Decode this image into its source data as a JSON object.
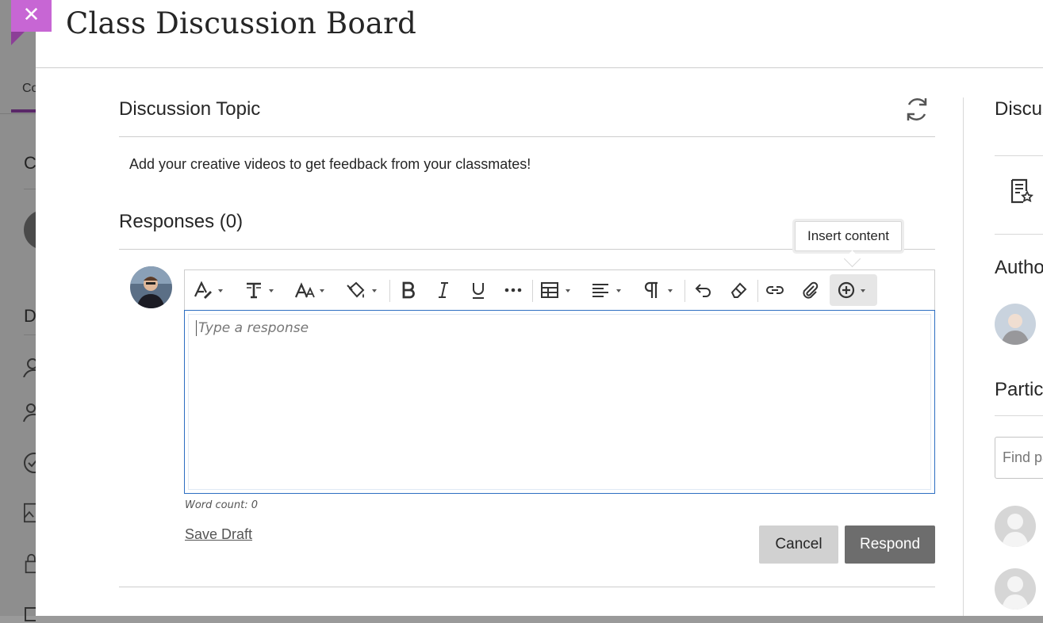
{
  "background": {
    "tab_label": "Co",
    "letters": [
      "C",
      "D"
    ]
  },
  "close_button": {
    "label": "✕"
  },
  "header": {
    "title": "Class Discussion Board"
  },
  "topic": {
    "heading": "Discussion Topic",
    "text": "Add your creative videos to get feedback from your classmates!"
  },
  "responses": {
    "heading": "Responses (0)"
  },
  "toolbar": {
    "tooltip": "Insert content",
    "buttons": [
      "text-style",
      "font",
      "font-size",
      "highlight-color",
      "bold",
      "italic",
      "underline",
      "more",
      "table",
      "align",
      "paragraph",
      "undo",
      "clear-formatting",
      "link",
      "attach",
      "insert-content"
    ]
  },
  "editor": {
    "placeholder": "Type a response",
    "word_count": "Word count: 0"
  },
  "actions": {
    "save_draft": "Save Draft",
    "cancel": "Cancel",
    "respond": "Respond"
  },
  "right_column": {
    "discussion_heading": "Discussion",
    "author_heading": "Author",
    "participants_heading": "Participants",
    "find_placeholder": "Find participants"
  },
  "colors": {
    "accent": "#c766d4",
    "editor_border": "#2d6ec2",
    "respond_button": "#6d6d6d",
    "cancel_button": "#d1d1d1"
  }
}
